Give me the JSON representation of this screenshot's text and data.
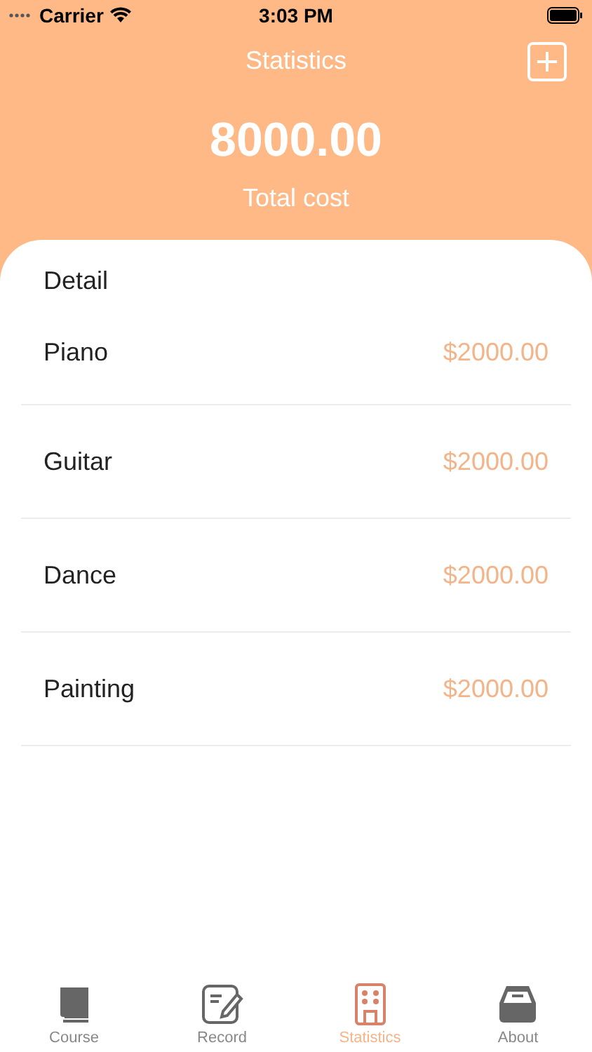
{
  "status_bar": {
    "carrier": "Carrier",
    "time": "3:03 PM"
  },
  "nav": {
    "title": "Statistics"
  },
  "summary": {
    "total": "8000.00",
    "label": "Total cost"
  },
  "detail": {
    "heading": "Detail",
    "items": [
      {
        "name": "Piano",
        "amount": "$2000.00"
      },
      {
        "name": "Guitar",
        "amount": "$2000.00"
      },
      {
        "name": "Dance",
        "amount": "$2000.00"
      },
      {
        "name": "Painting",
        "amount": "$2000.00"
      }
    ]
  },
  "tabs": [
    {
      "kind": "book",
      "label": "Course",
      "selected": false
    },
    {
      "kind": "note",
      "label": "Record",
      "selected": false
    },
    {
      "kind": "building",
      "label": "Statistics",
      "selected": true
    },
    {
      "kind": "tray",
      "label": "About",
      "selected": false
    }
  ]
}
